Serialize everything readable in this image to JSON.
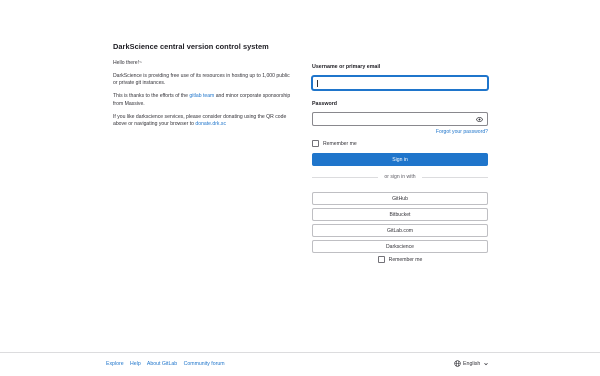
{
  "intro": {
    "title": "DarkScience central version control system",
    "greeting": "Hello there!~",
    "p1": "DarkScience is providing free use of its resources in hosting up to 1,000 public or private git instances.",
    "p2_prefix": "This is thanks to the efforts of the ",
    "p2_link": "gitlab team",
    "p2_suffix": " and minor corporate sponsorship from Massive.",
    "p3_prefix": "If you like darkscience services, please consider donating using the QR code above or navigating your browser to ",
    "p3_link": "donate.drk.sc"
  },
  "login": {
    "username_label": "Username or primary email",
    "username_value": "",
    "password_label": "Password",
    "password_value": "",
    "forgot_label": "Forgot your password?",
    "remember_label": "Remember me",
    "remember_checked": false,
    "signin_label": "Sign in",
    "divider_label": "or sign in with",
    "providers": [
      "GitHub",
      "Bitbucket",
      "GitLab.com",
      "Darkscience"
    ],
    "remember2_label": "Remember me"
  },
  "footer": {
    "links": [
      "Explore",
      "Help",
      "About GitLab",
      "Community forum"
    ],
    "language": "English"
  },
  "colors": {
    "accent": "#1f75cb",
    "text": "#333238",
    "border": "#89888d"
  },
  "icons": {
    "password_toggle": "eye-icon",
    "language": "globe-icon",
    "language_menu": "chevron-down-icon"
  }
}
